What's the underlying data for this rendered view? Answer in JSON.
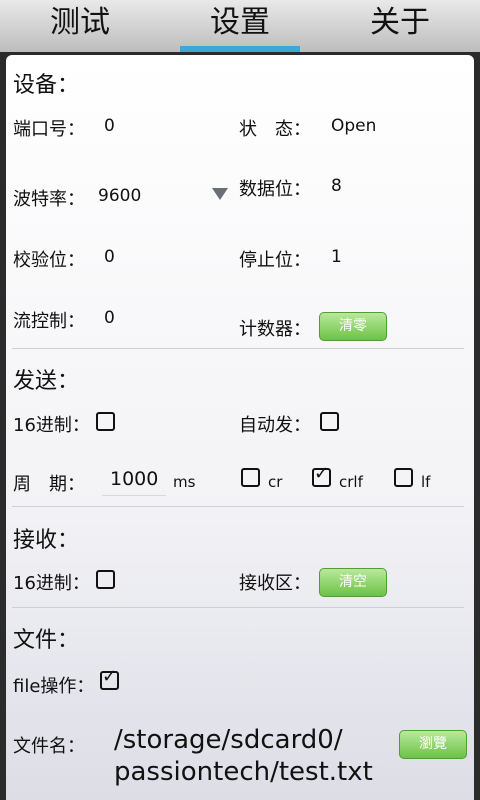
{
  "tabs": [
    {
      "label": "测试"
    },
    {
      "label": "设置"
    },
    {
      "label": "关于"
    }
  ],
  "device": {
    "title": "设备：",
    "port_label": "端口号：",
    "port_value": "0",
    "status_label": "状　态：",
    "status_value": "Open",
    "baud_label": "波特率：",
    "baud_value": "9600",
    "databits_label": "数据位：",
    "databits_value": "8",
    "parity_label": "校验位：",
    "parity_value": "0",
    "stopbits_label": "停止位：",
    "stopbits_value": "1",
    "flow_label": "流控制：",
    "flow_value": "0",
    "counter_label": "计数器：",
    "clear_button": "清零"
  },
  "send": {
    "title": "发送：",
    "hex_label": "16进制：",
    "auto_label": "自动发：",
    "period_label": "周　期：",
    "period_value": "1000",
    "period_unit": "ms",
    "cr_label": "cr",
    "crlf_label": "crlf",
    "lf_label": "lf"
  },
  "receive": {
    "title": "接收：",
    "hex_label": "16进制：",
    "area_label": "接收区：",
    "clear_button": "清空"
  },
  "file": {
    "title": "文件：",
    "op_label": "file操作：",
    "name_label": "文件名：",
    "path_line1": "/storage/sdcard0/",
    "path_line2": "passiontech/test.txt",
    "browse_button": "瀏覽"
  }
}
